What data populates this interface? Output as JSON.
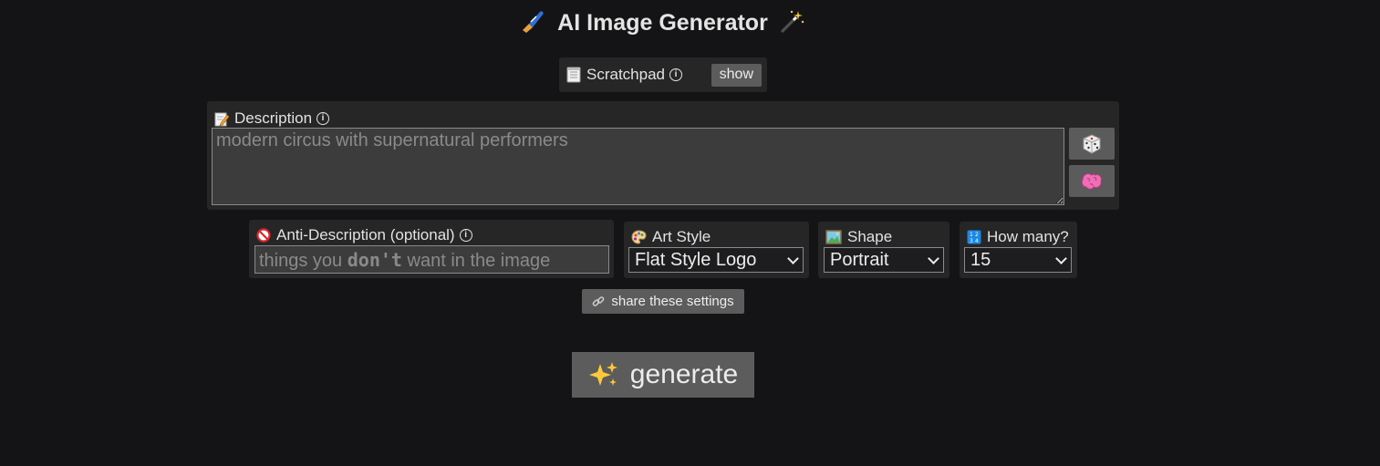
{
  "header": {
    "title": "AI Image Generator",
    "left_icon": "paintbrush-icon",
    "right_icon": "magic-wand-icon"
  },
  "scratchpad": {
    "label": "Scratchpad",
    "icon": "notepad-icon",
    "button_label": "show"
  },
  "description": {
    "label": "Description",
    "icon": "memo-pencil-icon",
    "placeholder": "modern circus with supernatural performers",
    "value": "",
    "random_button_icon": "dice-icon",
    "ai_button_icon": "brain-icon"
  },
  "anti_description": {
    "label": "Anti-Description (optional)",
    "icon": "prohibited-icon",
    "placeholder_before": "things you",
    "placeholder_bold": "don't",
    "placeholder_after": "want in the image"
  },
  "art_style": {
    "label": "Art Style",
    "icon": "palette-icon",
    "selected": "Flat Style Logo"
  },
  "shape": {
    "label": "Shape",
    "icon": "picture-icon",
    "selected": "Portrait"
  },
  "how_many": {
    "label": "How many?",
    "icon": "numbers-icon",
    "selected": "15"
  },
  "share": {
    "label": "share these settings",
    "icon": "link-icon"
  },
  "generate": {
    "label": "generate",
    "icon": "sparkles-icon"
  },
  "colors": {
    "background": "#141416",
    "panel": "#262626",
    "button": "#5c5c5c"
  }
}
